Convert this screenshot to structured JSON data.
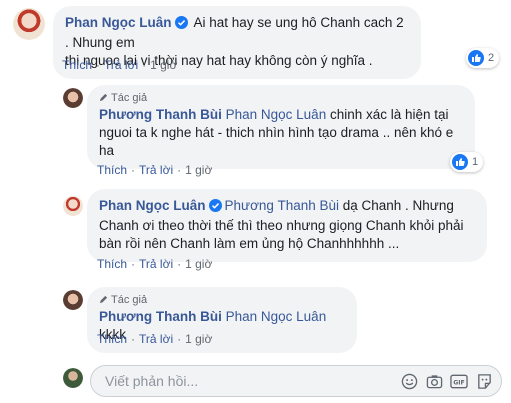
{
  "comments": [
    {
      "author": "Phan Ngọc Luân",
      "verified": true,
      "text_line1": "Ai hat hay se ung hô Chanh cach 2 . Nhung em",
      "text_line2": "thi nguoc lai vi thời nay hat hay không còn ý nghĩa .",
      "like_label": "Thích",
      "reply_label": "Trả lời",
      "time": "1 giờ",
      "reaction_count": "2"
    },
    {
      "author_badge": "Tác giả",
      "author": "Phương Thanh Bùi",
      "mention": "Phan Ngọc Luân",
      "text_line1": " chinh xác là hiện tại",
      "text_line2": "nguoi ta k nghe hát - thich nhìn hình tạo drama .. nên khó e",
      "text_line3": "ha",
      "like_label": "Thích",
      "reply_label": "Trả lời",
      "time": "1 giờ",
      "reaction_count": "1"
    },
    {
      "author": "Phan Ngọc Luân",
      "verified": true,
      "mention": "Phương Thanh Bùi",
      "text_line1": " dạ Chanh . Nhưng",
      "text_line2": "Chanh ơi theo thời thế thì theo nhưng giọng Chanh khỏi phải",
      "text_line3": "bàn rồi nên Chanh làm em ủng hộ Chanhhhhhh ...",
      "like_label": "Thích",
      "reply_label": "Trả lời",
      "time": "1 giờ"
    },
    {
      "author_badge": "Tác giả",
      "author": "Phương Thanh Bùi",
      "mention": "Phan Ngọc Luân",
      "text_line1": " kkkk",
      "like_label": "Thích",
      "reply_label": "Trả lời",
      "time": "1 giờ"
    }
  ],
  "composer": {
    "placeholder": "Viết phản hồi...",
    "icons": [
      "emoji-icon",
      "camera-icon",
      "gif-icon",
      "sticker-icon"
    ]
  },
  "colors": {
    "link": "#385898",
    "bubble": "#f2f3f5",
    "like_blue": "#1877f2"
  }
}
